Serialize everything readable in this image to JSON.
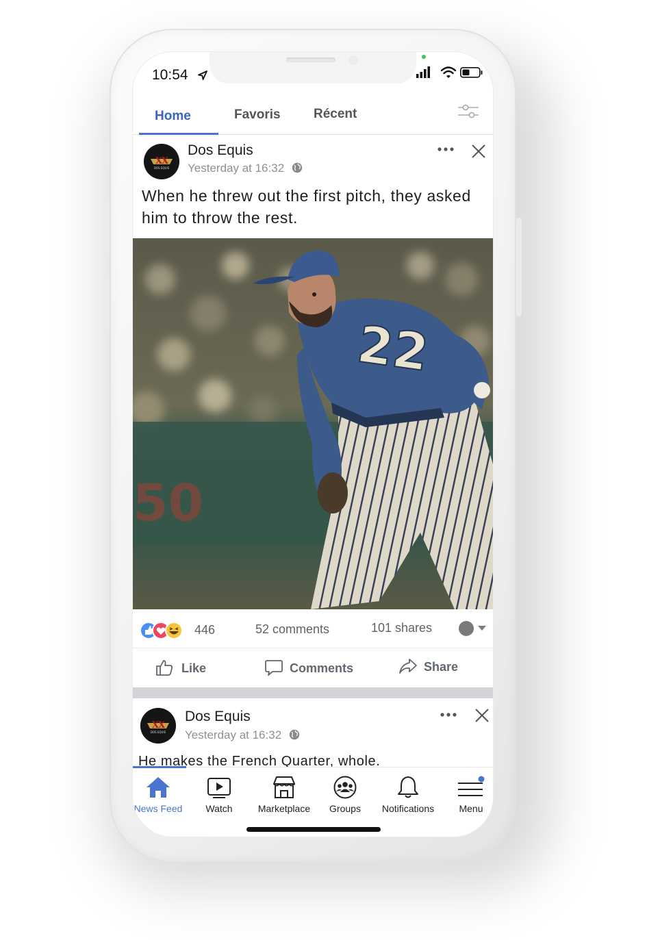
{
  "status_bar": {
    "time": "10:54"
  },
  "tabs": [
    {
      "label": "Home",
      "active": true
    },
    {
      "label": "Favoris",
      "active": false
    },
    {
      "label": "Récent",
      "active": false
    }
  ],
  "icons": {
    "location": "location-arrow-icon",
    "signal": "cellular-signal-icon",
    "wifi": "wifi-icon",
    "battery": "battery-icon",
    "filter": "filter-sliders-icon",
    "more": "more-dots-icon",
    "close": "close-icon",
    "globe": "globe-icon"
  },
  "posts": [
    {
      "author": "Dos Equis",
      "timestamp": "Yesterday at 16:32",
      "caption": "When he threw out the first pitch, they asked him to throw the rest.",
      "photo_alt": "Baseball pitcher with number 22 in a blue jersey",
      "jersey_number": "22",
      "wall_number": "50",
      "reactions": {
        "count": "446",
        "comments": "52 comments",
        "shares": "101 shares"
      },
      "actions": {
        "like": "Like",
        "comments": "Comments",
        "share": "Share"
      }
    },
    {
      "author": "Dos Equis",
      "timestamp": "Yesterday at 16:32",
      "caption": "He makes the French Quarter, whole."
    }
  ],
  "logo_text": {
    "mark": "XX",
    "brand": "DOS EQUIS"
  },
  "bottom_nav": [
    {
      "label": "News Feed",
      "icon": "home-icon",
      "active": true
    },
    {
      "label": "Watch",
      "icon": "video-play-icon",
      "active": false
    },
    {
      "label": "Marketplace",
      "icon": "storefront-icon",
      "active": false
    },
    {
      "label": "Groups",
      "icon": "groups-icon",
      "active": false
    },
    {
      "label": "Notifications",
      "icon": "bell-icon",
      "active": false
    },
    {
      "label": "Menu",
      "icon": "hamburger-menu-icon",
      "active": false
    }
  ],
  "colors": {
    "accent": "#4a74d0",
    "text": "#1c1e21",
    "muted": "#909090",
    "jersey": "#3a5a8c",
    "divider": "#d3d4d8"
  }
}
